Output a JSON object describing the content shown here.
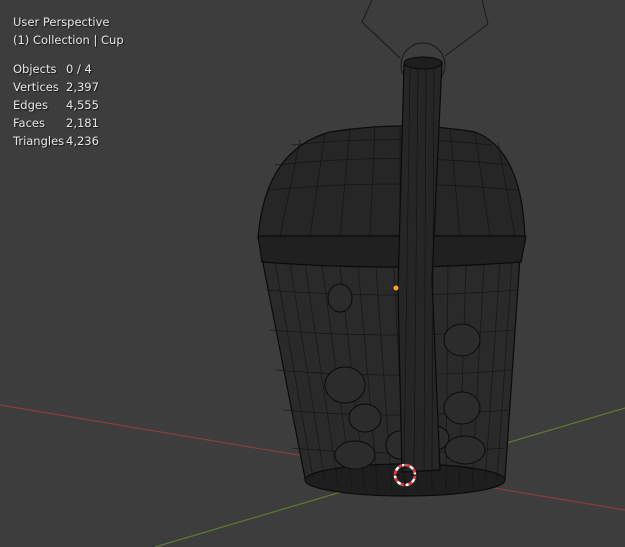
{
  "viewport": {
    "view_name": "User Perspective",
    "collection_line": "(1) Collection | Cup",
    "stats": [
      {
        "label": "Objects",
        "value": "0 / 4"
      },
      {
        "label": "Vertices",
        "value": "2,397"
      },
      {
        "label": "Edges",
        "value": "4,555"
      },
      {
        "label": "Faces",
        "value": "2,181"
      },
      {
        "label": "Triangles",
        "value": "4,236"
      }
    ]
  },
  "colors": {
    "background": "#3d3d3d",
    "x_axis": "#8a3c45",
    "y_axis": "#5f7a2e",
    "wireframe": "#000000",
    "origin_dot": "#f5a623",
    "cursor_red": "#e03030",
    "cursor_white": "#ffffff"
  }
}
